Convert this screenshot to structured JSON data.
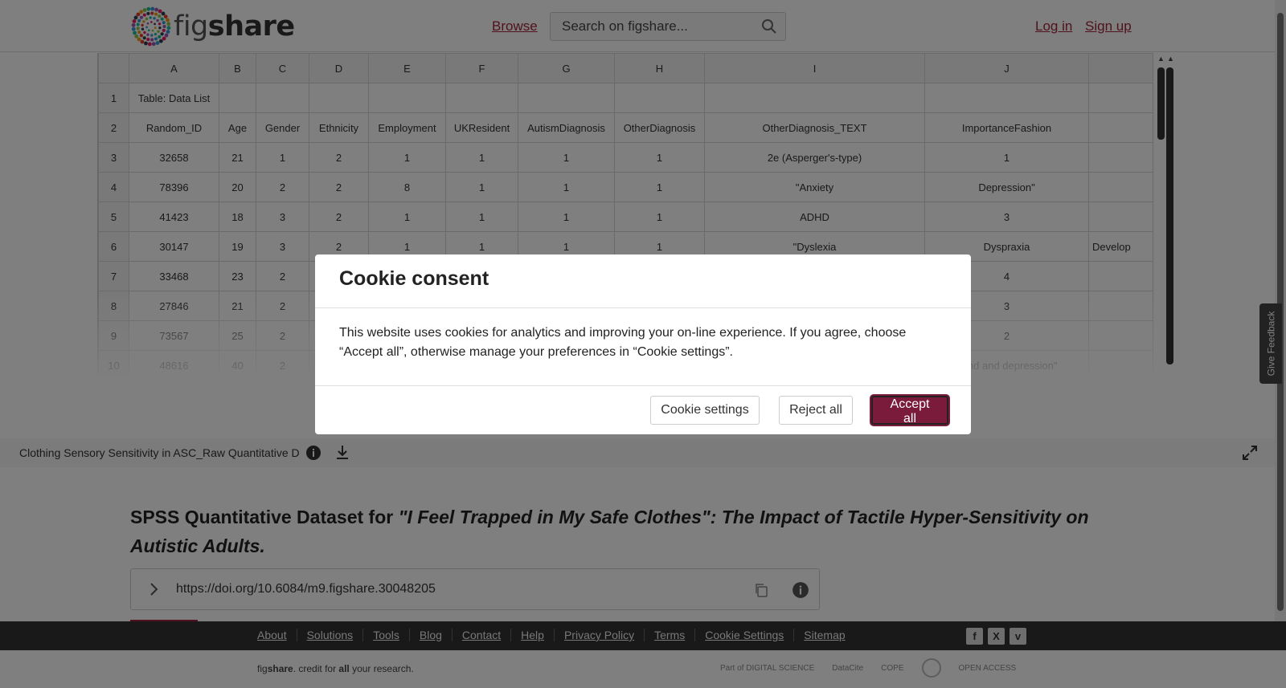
{
  "header": {
    "logo_text_light": "fig",
    "logo_text_bold": "share",
    "browse": "Browse",
    "search_placeholder": "Search on figshare...",
    "login": "Log in",
    "signup": "Sign up"
  },
  "sheet": {
    "columns": [
      "",
      "A",
      "B",
      "C",
      "D",
      "E",
      "F",
      "G",
      "H",
      "I",
      "J",
      ""
    ],
    "rows": [
      [
        "1",
        "Table: Data List",
        "",
        "",
        "",
        "",
        "",
        "",
        "",
        "",
        "",
        ""
      ],
      [
        "2",
        "Random_ID",
        "Age",
        "Gender",
        "Ethnicity",
        "Employment",
        "UKResident",
        "AutismDiagnosis",
        "OtherDiagnosis",
        "OtherDiagnosis_TEXT",
        "ImportanceFashion",
        ""
      ],
      [
        "3",
        "32658",
        "21",
        "1",
        "2",
        "1",
        "1",
        "1",
        "1",
        "2e (Asperger's-type)",
        "1",
        ""
      ],
      [
        "4",
        "78396",
        "20",
        "2",
        "2",
        "8",
        "1",
        "1",
        "1",
        "\"Anxiety",
        "Depression\"",
        ""
      ],
      [
        "5",
        "41423",
        "18",
        "3",
        "2",
        "1",
        "1",
        "1",
        "1",
        "ADHD",
        "3",
        ""
      ],
      [
        "6",
        "30147",
        "19",
        "3",
        "2",
        "1",
        "1",
        "1",
        "1",
        "\"Dyslexia",
        "Dyspraxia",
        "Develop"
      ],
      [
        "7",
        "33468",
        "23",
        "2",
        "",
        "",
        "",
        "",
        "",
        "",
        "4",
        ""
      ],
      [
        "8",
        "27846",
        "21",
        "2",
        "",
        "",
        "",
        "",
        "",
        "",
        "3",
        ""
      ],
      [
        "9",
        "73567",
        "25",
        "2",
        "",
        "",
        "",
        "",
        "",
        "",
        "2",
        ""
      ],
      [
        "10",
        "48616",
        "40",
        "2",
        "",
        "",
        "",
        "",
        "",
        "",
        "adhd and depression\"",
        ""
      ]
    ]
  },
  "file_bar": {
    "file_name": "Clothing Sensory Sensitivity in ASC_Raw Quantitative D"
  },
  "content": {
    "title_plain": "SPSS Quantitative Dataset for ",
    "title_italic": "\"I Feel Trapped in My Safe Clothes\": The Impact of Tactile Hyper-Sensitivity on Autistic Adults.",
    "doi": "https://doi.org/10.6084/m9.figshare.30048205"
  },
  "footer": {
    "links": [
      "About",
      "Solutions",
      "Tools",
      "Blog",
      "Contact",
      "Help",
      "Privacy Policy",
      "Terms",
      "Cookie Settings",
      "Sitemap"
    ],
    "social": [
      "f",
      "X",
      "v"
    ],
    "tagline_pre": "fig",
    "tagline_bold": "share",
    "tagline_mid": ". credit for ",
    "tagline_all": "all",
    "tagline_post": " your research.",
    "partners": [
      "Part of DIGITAL SCIENCE",
      "DataCite",
      "COPE",
      "",
      "OPEN ACCESS"
    ]
  },
  "feedback": "Give Feedback",
  "cookie_modal": {
    "title": "Cookie consent",
    "body": "This website uses cookies for analytics and improving your on-line experience. If you agree, choose “Accept all”, otherwise manage your preferences in “Cookie settings”.",
    "settings": "Cookie settings",
    "reject": "Reject all",
    "accept": "Accept all"
  },
  "colors": {
    "accent": "#a0243c",
    "accept_button": "#7a1b3b",
    "footer_bg": "#333333"
  }
}
